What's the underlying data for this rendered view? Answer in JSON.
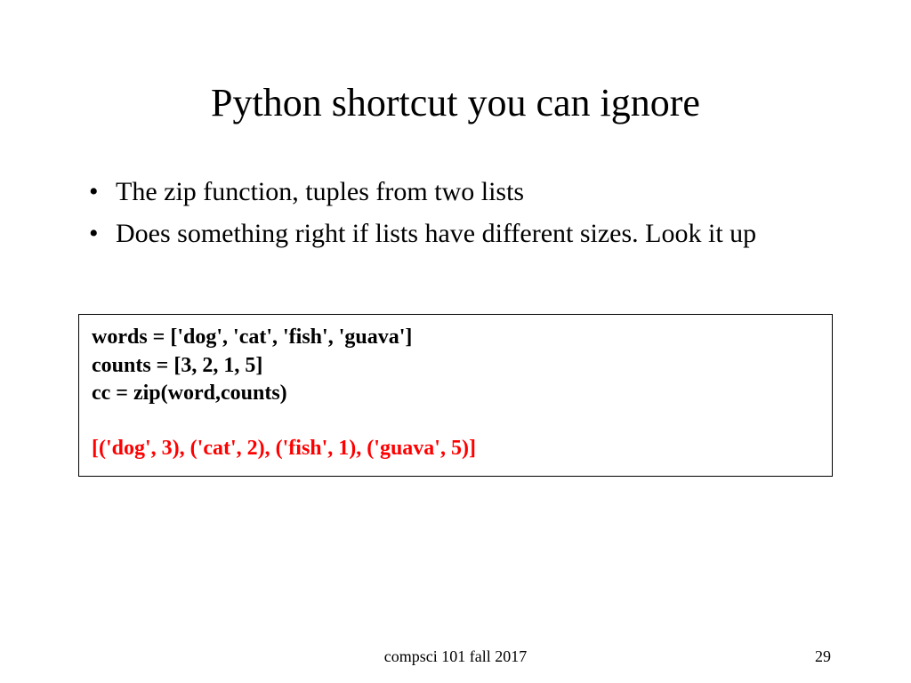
{
  "title": "Python shortcut you can ignore",
  "bullets": [
    "The zip function, tuples from two lists",
    "Does something right if lists have different sizes. Look it up"
  ],
  "code": {
    "line1": "words = ['dog', 'cat', 'fish', 'guava']",
    "line2": "counts = [3, 2, 1, 5]",
    "line3": "cc = zip(word,counts)",
    "output": "[('dog', 3), ('cat', 2), ('fish', 1), ('guava', 5)]"
  },
  "footer": {
    "course": "compsci 101 fall 2017",
    "page": "29"
  }
}
